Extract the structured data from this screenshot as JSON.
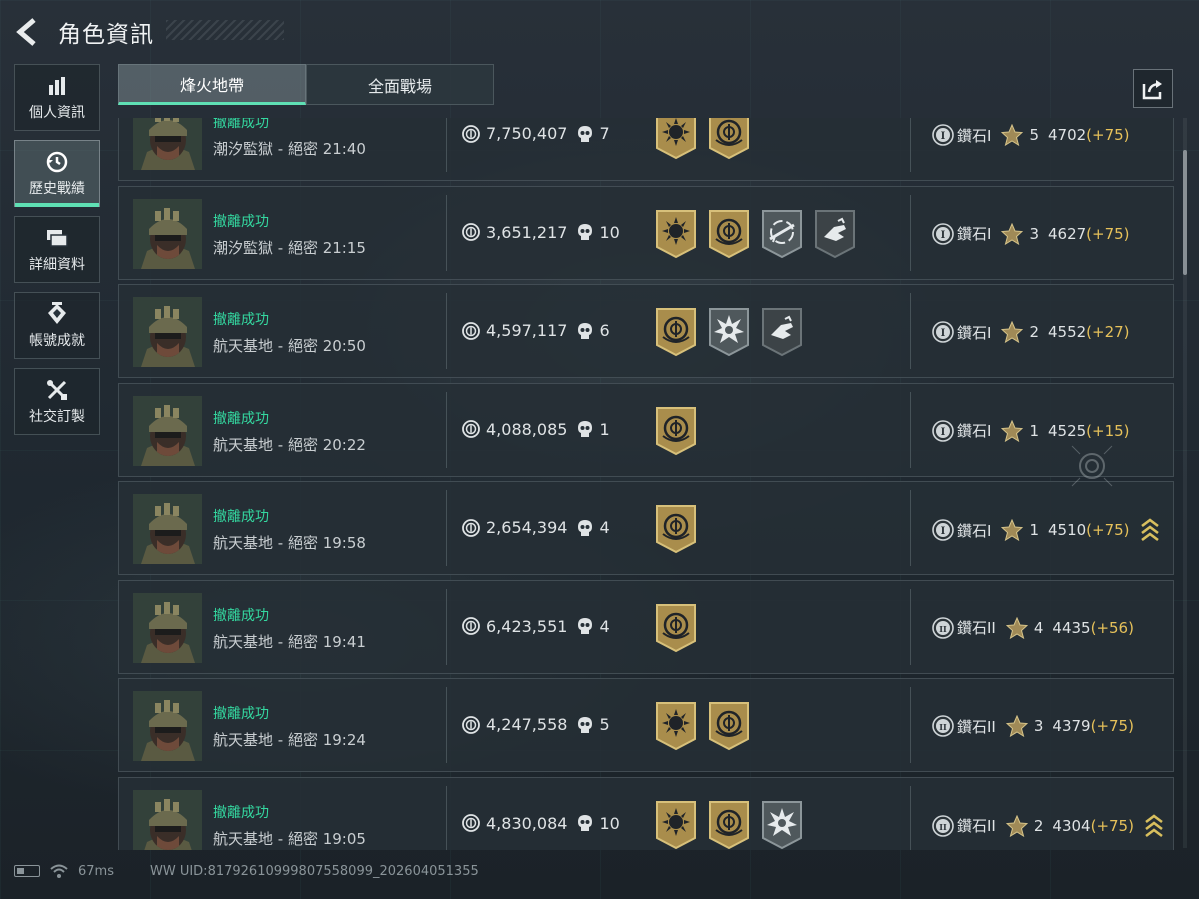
{
  "header": {
    "title": "角色資訊"
  },
  "sidebar": {
    "items": [
      {
        "label": "個人資訊",
        "icon": "bar-chart-icon",
        "active": false
      },
      {
        "label": "歷史戰績",
        "icon": "history-clock-icon",
        "active": true
      },
      {
        "label": "詳細資料",
        "icon": "cards-icon",
        "active": false
      },
      {
        "label": "帳號成就",
        "icon": "achievement-icon",
        "active": false
      },
      {
        "label": "社交訂製",
        "icon": "tools-icon",
        "active": false
      }
    ]
  },
  "tabs": [
    {
      "label": "烽火地帶",
      "active": true
    },
    {
      "label": "全面戰場",
      "active": false
    }
  ],
  "colors": {
    "accent": "#5fe0b4",
    "success": "#34d8a0",
    "delta": "#e6c15a",
    "gold_badge": "#b49550",
    "gray_badge": "#5a6266"
  },
  "matches": [
    {
      "status": "撤離成功",
      "map": "潮汐監獄 - 絕密 21:40",
      "worth": "7,750,407",
      "kills": "7",
      "badges": [
        "sun-emblem-gold",
        "crest-gold"
      ],
      "rank": "鑽石I",
      "rank_icon": "rank-I-icon",
      "stars": "5",
      "score": "4702",
      "delta": "(+75)",
      "chevron": false
    },
    {
      "status": "撤離成功",
      "map": "潮汐監獄 - 絕密 21:15",
      "worth": "3,651,217",
      "kills": "10",
      "badges": [
        "sun-emblem-gold",
        "crest-gold",
        "rifle-gray",
        "hand-gray-dark"
      ],
      "rank": "鑽石I",
      "rank_icon": "rank-I-icon",
      "stars": "3",
      "score": "4627",
      "delta": "(+75)",
      "chevron": false
    },
    {
      "status": "撤離成功",
      "map": "航天基地 - 絕密 20:50",
      "worth": "4,597,117",
      "kills": "6",
      "badges": [
        "crest-gold",
        "burst-gray",
        "hand-gray-dark"
      ],
      "rank": "鑽石I",
      "rank_icon": "rank-I-icon",
      "stars": "2",
      "score": "4552",
      "delta": "(+27)",
      "chevron": false
    },
    {
      "status": "撤離成功",
      "map": "航天基地 - 絕密 20:22",
      "worth": "4,088,085",
      "kills": "1",
      "badges": [
        "crest-gold"
      ],
      "rank": "鑽石I",
      "rank_icon": "rank-I-icon",
      "stars": "1",
      "score": "4525",
      "delta": "(+15)",
      "chevron": false
    },
    {
      "status": "撤離成功",
      "map": "航天基地 - 絕密 19:58",
      "worth": "2,654,394",
      "kills": "4",
      "badges": [
        "crest-gold"
      ],
      "rank": "鑽石I",
      "rank_icon": "rank-I-icon",
      "stars": "1",
      "score": "4510",
      "delta": "(+75)",
      "chevron": true
    },
    {
      "status": "撤離成功",
      "map": "航天基地 - 絕密 19:41",
      "worth": "6,423,551",
      "kills": "4",
      "badges": [
        "crest-gold"
      ],
      "rank": "鑽石II",
      "rank_icon": "rank-II-icon",
      "stars": "4",
      "score": "4435",
      "delta": "(+56)",
      "chevron": false
    },
    {
      "status": "撤離成功",
      "map": "航天基地 - 絕密 19:24",
      "worth": "4,247,558",
      "kills": "5",
      "badges": [
        "sun-emblem-gold",
        "crest-gold"
      ],
      "rank": "鑽石II",
      "rank_icon": "rank-II-icon",
      "stars": "3",
      "score": "4379",
      "delta": "(+75)",
      "chevron": false
    },
    {
      "status": "撤離成功",
      "map": "航天基地 - 絕密 19:05",
      "worth": "4,830,084",
      "kills": "10",
      "badges": [
        "sun-emblem-gold",
        "crest-gold",
        "burst-gray"
      ],
      "rank": "鑽石II",
      "rank_icon": "rank-II-icon",
      "stars": "2",
      "score": "4304",
      "delta": "(+75)",
      "chevron": true
    }
  ],
  "footer": {
    "ping": "67ms",
    "uid": "WW UID:817926109998075580​99_202604051355"
  }
}
